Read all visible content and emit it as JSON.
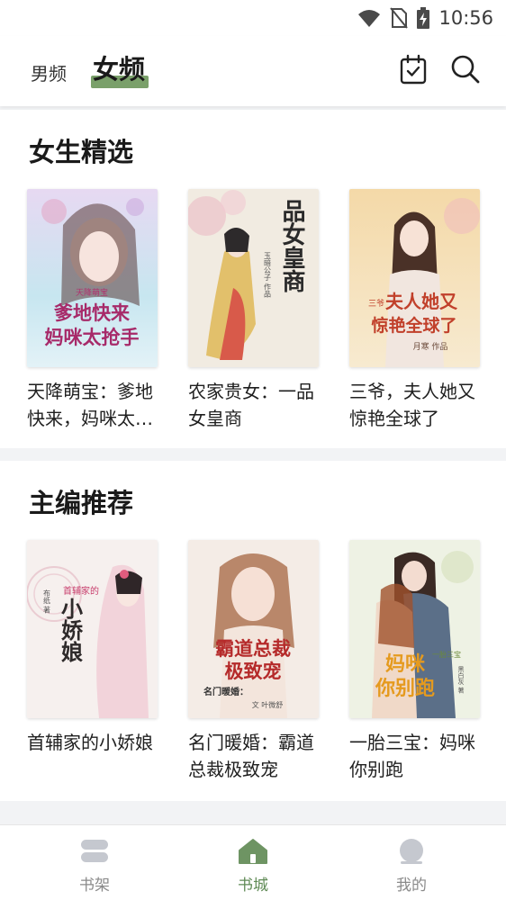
{
  "status_bar": {
    "time": "10:56",
    "icons": [
      "wifi-icon",
      "no-sim-icon",
      "battery-charging-icon"
    ]
  },
  "header": {
    "tabs": [
      {
        "label": "男频",
        "active": false
      },
      {
        "label": "女频",
        "active": true
      }
    ],
    "actions": [
      "checkin-calendar-icon",
      "search-icon"
    ],
    "accent_color": "#7aa06a"
  },
  "sections": [
    {
      "title": "女生精选",
      "books": [
        {
          "title": "天降萌宝：爹地快来，妈咪太抢手"
        },
        {
          "title": "农家贵女：一品女皇商"
        },
        {
          "title": "三爷，夫人她又惊艳全球了"
        }
      ]
    },
    {
      "title": "主编推荐",
      "books": [
        {
          "title": "首辅家的小娇娘"
        },
        {
          "title": "名门暖婚：霸道总裁极致宠"
        },
        {
          "title": "一胎三宝：妈咪你别跑"
        }
      ]
    }
  ],
  "covers": {
    "s0b0": {
      "lines": [
        "天降萌宝",
        "爹地快来",
        "妈咪太抢手"
      ]
    },
    "s0b1": {
      "lines": [
        "一品女皇商",
        "玉暗公子 作品"
      ]
    },
    "s0b2": {
      "lines": [
        "三爷",
        "夫人她又",
        "惊艳全球了",
        "月寒 作品"
      ]
    },
    "s1b0": {
      "lines": [
        "首辅家的",
        "小娇娘",
        "布纸 著"
      ]
    },
    "s1b1": {
      "lines": [
        "名门暖婚：",
        "霸道总裁",
        "极致宠",
        "文 叶微舒"
      ]
    },
    "s1b2": {
      "lines": [
        "一胎三宝",
        "妈咪",
        "你别跑",
        "黑白灰 著"
      ]
    }
  },
  "bottom_nav": [
    {
      "label": "书架",
      "icon": "bookshelf-icon",
      "active": false
    },
    {
      "label": "书城",
      "icon": "home-icon",
      "active": true
    },
    {
      "label": "我的",
      "icon": "profile-icon",
      "active": false
    }
  ],
  "colors": {
    "active_green": "#5f8a55",
    "inactive_gray": "#8a8a8a",
    "page_bg": "#f2f3f5"
  }
}
